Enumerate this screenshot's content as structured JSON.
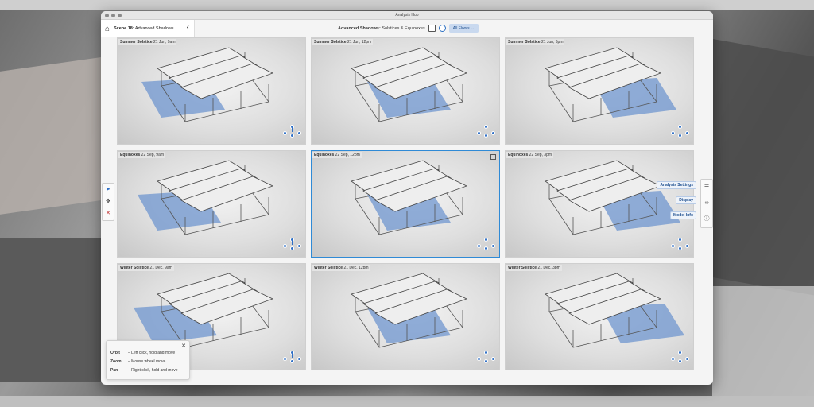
{
  "window": {
    "title": "Analysis Hub"
  },
  "toolbar": {
    "scene_prefix": "Scene 18:",
    "scene_name": "Advanced Shadows",
    "mode_title": "Advanced Shadows:",
    "mode_subtitle": "Solstices & Equinoxes",
    "dropdown_label": "All Floors"
  },
  "cells": [
    {
      "label_bold": "Summer Solstice",
      "label_rest": "21 Jun, 9am",
      "selected": false
    },
    {
      "label_bold": "Summer Solstice",
      "label_rest": "21 Jun, 12pm",
      "selected": false
    },
    {
      "label_bold": "Summer Solstice",
      "label_rest": "21 Jun, 3pm",
      "selected": false
    },
    {
      "label_bold": "Equinoxes",
      "label_rest": "22 Sep, 9am",
      "selected": false
    },
    {
      "label_bold": "Equinoxes",
      "label_rest": "22 Sep, 12pm",
      "selected": true
    },
    {
      "label_bold": "Equinoxes",
      "label_rest": "22 Sep, 3pm",
      "selected": false
    },
    {
      "label_bold": "Winter Solstice",
      "label_rest": "21 Dec, 9am",
      "selected": false
    },
    {
      "label_bold": "Winter Solstice",
      "label_rest": "21 Dec, 12pm",
      "selected": false
    },
    {
      "label_bold": "Winter Solstice",
      "label_rest": "21 Dec, 3pm",
      "selected": false
    }
  ],
  "right_panel": {
    "analysis_settings": "Analysis Settings",
    "display": "Display",
    "model_info": "Model Info"
  },
  "help": {
    "rows": [
      {
        "key": "Orbit",
        "desc": "– Left click, hold and move"
      },
      {
        "key": "Zoom",
        "desc": "– Mouse wheel move"
      },
      {
        "key": "Pan",
        "desc": "– Right click, hold and move"
      }
    ]
  },
  "colors": {
    "accent": "#2e6fc6",
    "shadow": "#6f96cf",
    "selection": "#2f8ad6"
  }
}
